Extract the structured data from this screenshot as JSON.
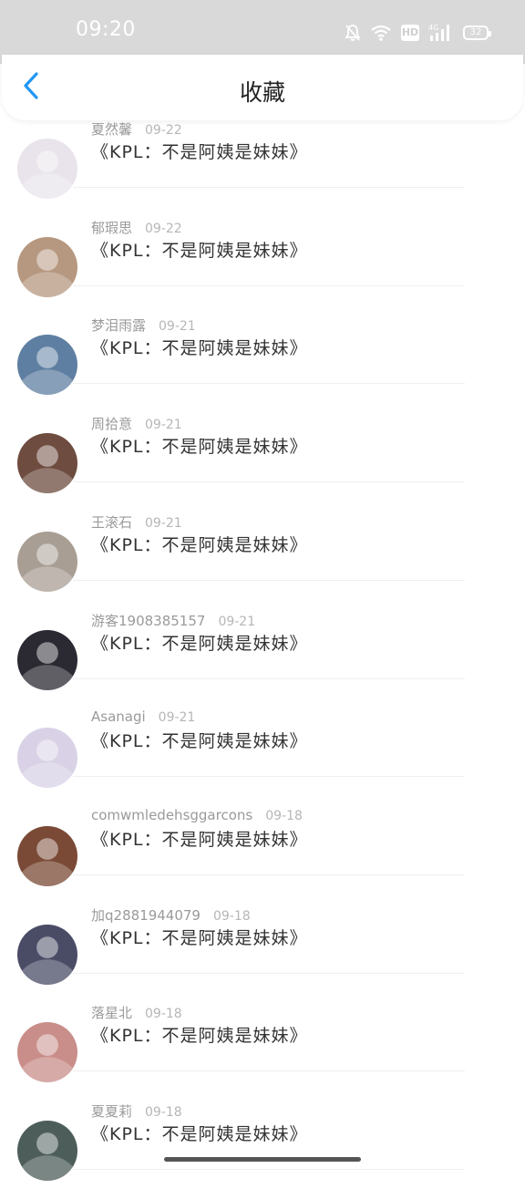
{
  "status_bar": {
    "time": "09:20",
    "battery": "32",
    "hd": "HD",
    "network": "4G"
  },
  "header": {
    "title": "收藏",
    "back_icon": "chevron-left-icon"
  },
  "colors": {
    "accent": "#2196f3",
    "status_bar_bg": "#d9d9d9"
  },
  "items": [
    {
      "name": "夏然馨",
      "date": "09-22",
      "title": "《KPL：不是阿姨是妹妹》",
      "avatar": "#e9e4ec"
    },
    {
      "name": "郁瑕思",
      "date": "09-22",
      "title": "《KPL：不是阿姨是妹妹》",
      "avatar": "#b6977f"
    },
    {
      "name": "梦泪雨露",
      "date": "09-21",
      "title": "《KPL：不是阿姨是妹妹》",
      "avatar": "#5f7fa2"
    },
    {
      "name": "周拾意",
      "date": "09-21",
      "title": "《KPL：不是阿姨是妹妹》",
      "avatar": "#6e4c3f"
    },
    {
      "name": "王滚石",
      "date": "09-21",
      "title": "《KPL：不是阿姨是妹妹》",
      "avatar": "#a89e94"
    },
    {
      "name": "游客1908385157",
      "date": "09-21",
      "title": "《KPL：不是阿姨是妹妹》",
      "avatar": "#2b2a33"
    },
    {
      "name": "Asanagi",
      "date": "09-21",
      "title": "《KPL：不是阿姨是妹妹》",
      "avatar": "#d9d2e6"
    },
    {
      "name": "comwmledehsggarcons",
      "date": "09-18",
      "title": "《KPL：不是阿姨是妹妹》",
      "avatar": "#7a4a36"
    },
    {
      "name": "加q2881944079",
      "date": "09-18",
      "title": "《KPL：不是阿姨是妹妹》",
      "avatar": "#4a4c66"
    },
    {
      "name": "落星北",
      "date": "09-18",
      "title": "《KPL：不是阿姨是妹妹》",
      "avatar": "#c98e8a"
    },
    {
      "name": "夏夏莉",
      "date": "09-18",
      "title": "《KPL：不是阿姨是妹妹》",
      "avatar": "#4d5e5a"
    }
  ]
}
